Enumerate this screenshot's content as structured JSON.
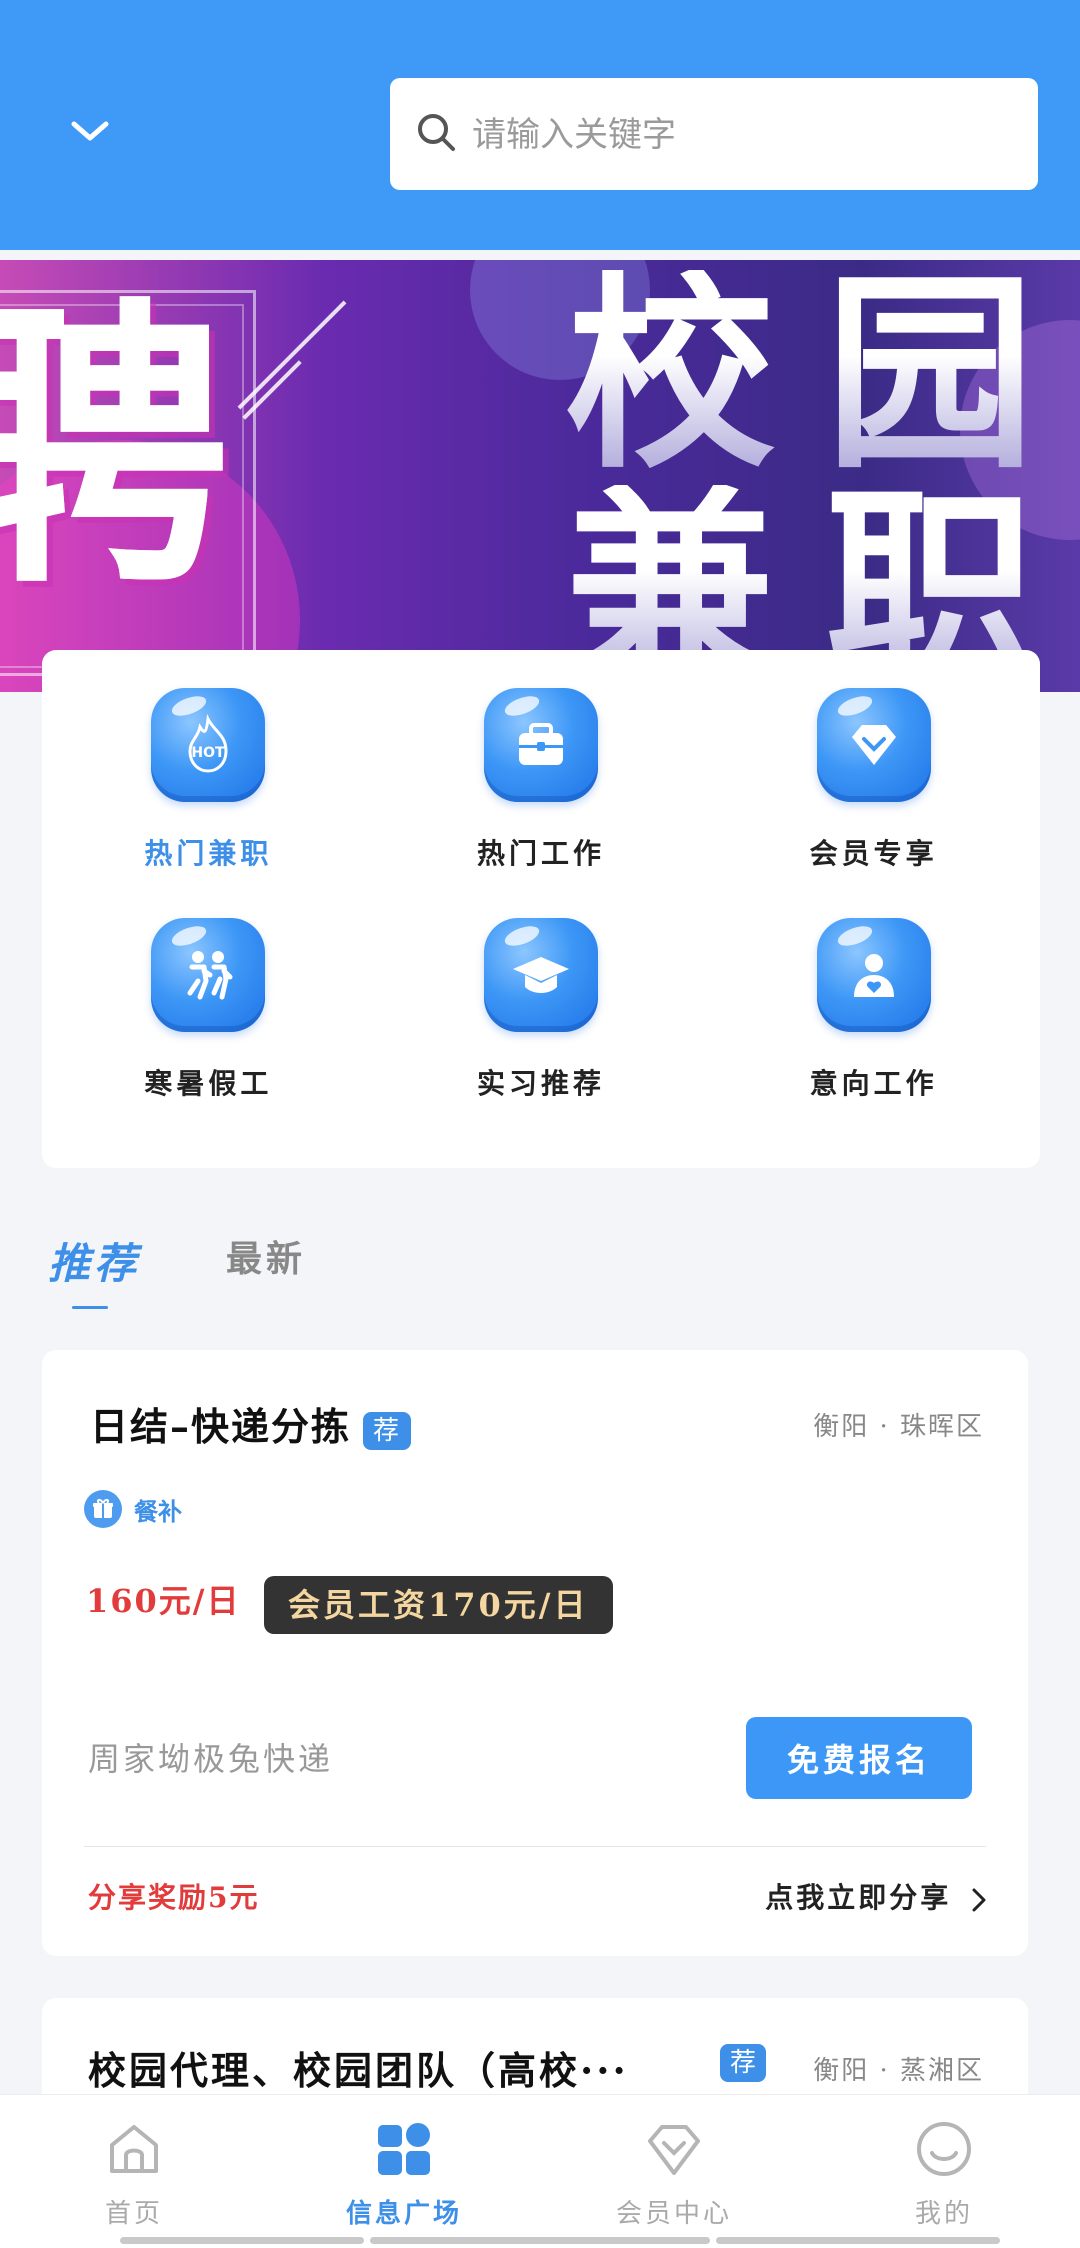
{
  "header": {
    "search_placeholder": "请输入关键字"
  },
  "banner": {
    "left_char": "聘",
    "title_chars": [
      "校",
      "园",
      "兼",
      "职"
    ]
  },
  "categories": [
    {
      "label": "热门兼职",
      "icon": "hot-icon",
      "active": true
    },
    {
      "label": "热门工作",
      "icon": "briefcase-icon",
      "active": false
    },
    {
      "label": "会员专享",
      "icon": "diamond-icon",
      "active": false
    },
    {
      "label": "寒暑假工",
      "icon": "people-running-icon",
      "active": false
    },
    {
      "label": "实习推荐",
      "icon": "graduation-cap-icon",
      "active": false
    },
    {
      "label": "意向工作",
      "icon": "user-heart-icon",
      "active": false
    }
  ],
  "tabs": {
    "recommend": "推荐",
    "latest": "最新"
  },
  "jobs": [
    {
      "title": "日结–快递分拣",
      "tag": "荐",
      "location": "衡阳 · 珠晖区",
      "benefit": "餐补",
      "wage": "160元/日",
      "member_wage": "会员工资170元/日",
      "company": "周家坳极兔快递",
      "apply_label": "免费报名",
      "share_reward": "分享奖励5元",
      "share_link": "点我立即分享"
    },
    {
      "title": "校园代理、校园团队（高校···",
      "tag": "荐",
      "location": "衡阳 · 蒸湘区"
    }
  ],
  "bottom_nav": [
    {
      "label": "首页",
      "icon": "home-icon",
      "active": false
    },
    {
      "label": "信息广场",
      "icon": "grid-icon",
      "active": true
    },
    {
      "label": "会员中心",
      "icon": "diamond-icon",
      "active": false
    },
    {
      "label": "我的",
      "icon": "smile-icon",
      "active": false
    }
  ],
  "colors": {
    "primary": "#3f9af7",
    "accent_text": "#3d8fe8",
    "price_red": "#e23b3b",
    "member_badge_bg": "#333333",
    "member_badge_text": "#f4d6a0"
  }
}
